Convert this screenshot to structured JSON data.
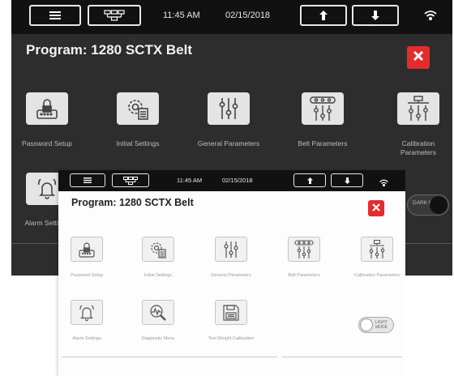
{
  "dark_screen": {
    "status_bar": {
      "time": "11:45 AM",
      "date": "02/15/2018"
    },
    "program_title": "Program: 1280 SCTX Belt",
    "tiles": [
      {
        "label": "Password Setup",
        "icon": "password-icon"
      },
      {
        "label": "Initial Settings",
        "icon": "gear-document-icon"
      },
      {
        "label": "General Parameters",
        "icon": "sliders-icon"
      },
      {
        "label": "Belt Parameters",
        "icon": "belt-sliders-icon"
      },
      {
        "label": "Calibration Parameters",
        "icon": "calibration-sliders-icon"
      },
      {
        "label": "Alarm Settings",
        "icon": "bell-icon"
      }
    ],
    "mode_toggle_label": "DARK MODE"
  },
  "light_screen": {
    "status_bar": {
      "time": "11:45 AM",
      "date": "02/15/2018"
    },
    "program_title": "Program: 1280 SCTX Belt",
    "tiles": [
      {
        "label": "Password Setup",
        "icon": "password-icon"
      },
      {
        "label": "Initial Settings",
        "icon": "gear-document-icon"
      },
      {
        "label": "General Parameters",
        "icon": "sliders-icon"
      },
      {
        "label": "Belt Parameters",
        "icon": "belt-sliders-icon"
      },
      {
        "label": "Calibration Parameters",
        "icon": "calibration-sliders-icon"
      },
      {
        "label": "Alarm Settings",
        "icon": "bell-icon"
      },
      {
        "label": "Diagnostic Menu",
        "icon": "diagnostic-magnifier-icon"
      },
      {
        "label": "Test Weight Calibration",
        "icon": "floppy-disk-icon"
      }
    ],
    "mode_toggle_label": "LIGHT MODE"
  },
  "colors": {
    "close_red": "#e42c2c",
    "dark_bg": "#2d2d2d",
    "top_bar": "#111111"
  }
}
